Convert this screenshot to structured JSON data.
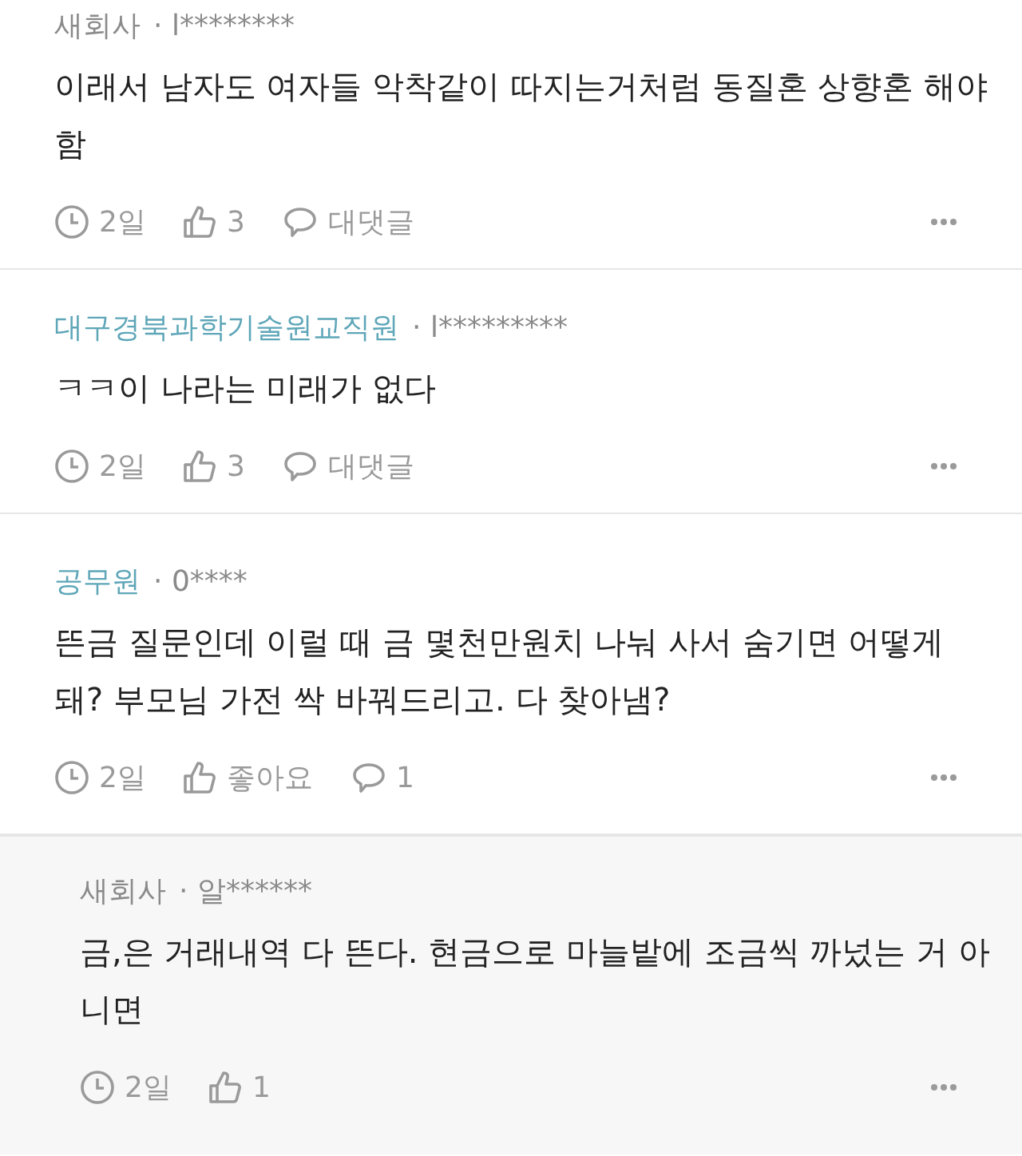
{
  "comments": [
    {
      "kind": "comment",
      "author": "새회사",
      "color": "#8a8a8a",
      "user": "· l********",
      "text": "이래서 남자도 여자들 악착같이 따지는거처럼 동질혼 상향혼 해야함",
      "time": "2일",
      "likes": "3",
      "reply_label": "대댓글"
    },
    {
      "kind": "comment",
      "author": "대구경북과학기술원교직원",
      "color": "#5ea6b8",
      "user": "· l*********",
      "text": "ㅋㅋ이 나라는 미래가 없다",
      "time": "2일",
      "likes": "3",
      "reply_label": "대댓글"
    },
    {
      "kind": "comment",
      "author": "공무원",
      "color": "#5ea6b8",
      "user": "· 0****",
      "text": "뜬금 질문인데 이럴 때 금 몇천만원치 나눠 사서 숨기면 어떻게 돼? 부모님 가전 싹 바꿔드리고. 다 찾아냄?",
      "time": "2일",
      "likes": "좋아요",
      "reply_label": "1"
    },
    {
      "kind": "reply",
      "author": "새회사",
      "color": "#8a8a8a",
      "user": "· 알******",
      "text": "금,은 거래내역 다 뜬다. 현금으로 마늘밭에 조금씩 까넜는 거 아니면",
      "time": "2일",
      "likes": "1"
    }
  ]
}
